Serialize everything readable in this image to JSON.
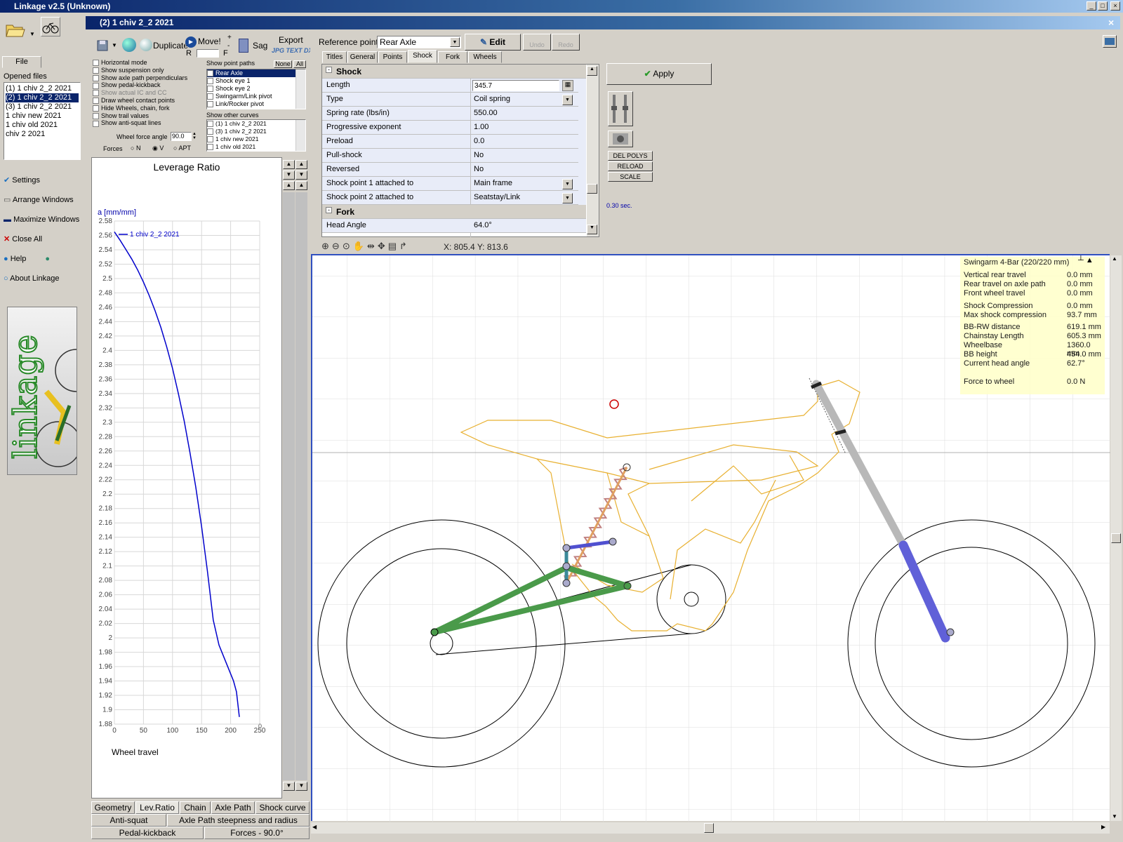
{
  "app": {
    "title": "Linkage v2.5 (Unknown)"
  },
  "child": {
    "title": "(2) 1 chiv 2_2 2021"
  },
  "left_panel": {
    "file_tab": "File",
    "opened_files_label": "Opened files",
    "files": [
      "(1) 1 chiv 2_2 2021",
      "(2) 1 chiv 2_2 2021",
      "(3) 1 chiv 2_2 2021",
      "1 chiv new 2021",
      "1 chiv old 2021",
      "chiv 2 2021"
    ],
    "menu": [
      "Settings",
      "Arrange Windows",
      "Maximize Windows",
      "Close All",
      "Help",
      "About Linkage"
    ],
    "logo_text": "linkage"
  },
  "toolbar": {
    "duplicate": "Duplicate",
    "move": "Move!",
    "sag": "Sag",
    "export": "Export",
    "export_formats": "JPG TEXT DXF",
    "r": "R",
    "f": "F",
    "plus": "+",
    "minus": "-"
  },
  "options": {
    "checkboxes": [
      "Horizontal mode",
      "Show suspension only",
      "Show axle path perpendiculars",
      "Show pedal-kickback",
      "Show actual IC and CC",
      "Draw wheel contact points",
      "Hide Wheels, chain, fork",
      "Show trail values",
      "Show anti-squat lines"
    ],
    "wheel_force_angle_label": "Wheel force angle",
    "wheel_force_angle_value": "90.0",
    "forces_label": "Forces",
    "forces_opts": [
      "N",
      "V",
      "APT"
    ],
    "point_paths_label": "Show point paths",
    "none": "None",
    "all": "All",
    "point_paths": [
      "Rear Axle",
      "Shock eye 1",
      "Shock eye 2",
      "Swingarm/Link pivot",
      "Link/Rocker pivot"
    ],
    "other_curves_label": "Show other curves",
    "other_curves": [
      "(1) 1 chiv 2_2 2021",
      "(3) 1 chiv 2_2 2021",
      "1 chiv new 2021",
      "1 chiv old 2021"
    ]
  },
  "chart_data": {
    "type": "line",
    "title": "Leverage Ratio",
    "ylabel": "a [mm/mm]",
    "xlabel": "Wheel travel",
    "xlim": [
      0,
      250
    ],
    "ylim": [
      1.88,
      2.58
    ],
    "xticks": [
      "0",
      "50",
      "100",
      "150",
      "200",
      "250"
    ],
    "yticks": [
      "2.58",
      "2.56",
      "2.54",
      "2.52",
      "2.5",
      "2.48",
      "2.46",
      "2.44",
      "2.42",
      "2.4",
      "2.38",
      "2.36",
      "2.34",
      "2.32",
      "2.3",
      "2.28",
      "2.26",
      "2.24",
      "2.22",
      "2.2",
      "2.18",
      "2.16",
      "2.14",
      "2.12",
      "2.1",
      "2.08",
      "2.06",
      "2.04",
      "2.02",
      "2",
      "1.98",
      "1.96",
      "1.94",
      "1.92",
      "1.9",
      "1.88"
    ],
    "end_label": "0",
    "series": [
      {
        "name": "1 chiv 2_2 2021",
        "color": "#0000cc",
        "x": [
          0,
          10,
          20,
          30,
          40,
          50,
          60,
          70,
          80,
          90,
          100,
          110,
          120,
          130,
          140,
          150,
          160,
          170,
          180,
          190,
          200,
          205,
          210,
          215
        ],
        "y": [
          2.565,
          2.553,
          2.54,
          2.527,
          2.512,
          2.495,
          2.476,
          2.455,
          2.432,
          2.405,
          2.375,
          2.34,
          2.302,
          2.258,
          2.21,
          2.155,
          2.093,
          2.025,
          1.99,
          1.97,
          1.95,
          1.94,
          1.925,
          1.89
        ]
      }
    ]
  },
  "bottom_tabs": {
    "row1": [
      "Geometry",
      "Lev.Ratio",
      "Chain",
      "Axle Path",
      "Shock curve"
    ],
    "row2": [
      "Anti-squat",
      "Axle Path steepness and radius"
    ],
    "row3": [
      "Pedal-kickback",
      "Forces - 90.0°"
    ]
  },
  "properties": {
    "reference_label": "Reference point",
    "reference_value": "Rear Axle",
    "edit": "Edit",
    "undo": "Undo",
    "redo": "Redo",
    "tabs": [
      "Titles",
      "General",
      "Points",
      "Shock",
      "Fork",
      "Wheels"
    ],
    "sections": {
      "shock": "Shock",
      "fork": "Fork"
    },
    "rows": [
      {
        "name": "Length",
        "value": "345.7"
      },
      {
        "name": "Type",
        "value": "Coil spring"
      },
      {
        "name": "Spring rate (lbs/in)",
        "value": "550.00"
      },
      {
        "name": "Progressive exponent",
        "value": "1.00"
      },
      {
        "name": "Preload",
        "value": "0.0"
      },
      {
        "name": "Pull-shock",
        "value": "No"
      },
      {
        "name": "Reversed",
        "value": "No"
      },
      {
        "name": "Shock point 1 attached to",
        "value": "Main frame"
      },
      {
        "name": "Shock point 2 attached to",
        "value": "Seatstay/Link"
      }
    ],
    "fork_rows": [
      {
        "name": "Head Angle",
        "value": "64.0°"
      }
    ]
  },
  "actions": {
    "apply": "Apply",
    "del_polys": "DEL POLYS",
    "reload": "RELOAD",
    "scale": "SCALE",
    "timing": "0.30 sec."
  },
  "canvas": {
    "coords": "X: 805.4  Y: 813.6"
  },
  "info": {
    "title": "Swingarm 4-Bar (220/220 mm)",
    "rows": [
      {
        "k": "Vertical rear travel",
        "v": "0.0 mm"
      },
      {
        "k": "Rear travel on axle path",
        "v": "0.0 mm"
      },
      {
        "k": "Front wheel travel",
        "v": "0.0 mm"
      },
      {
        "k": "Shock Compression",
        "v": "0.0 mm"
      },
      {
        "k": "Max shock compression",
        "v": "93.7 mm"
      },
      {
        "k": "BB-RW distance",
        "v": "619.1 mm"
      },
      {
        "k": "Chainstay Length",
        "v": "605.3 mm"
      },
      {
        "k": "Wheelbase",
        "v": "1360.0 mm"
      },
      {
        "k": "BB height",
        "v": "454.0 mm"
      },
      {
        "k": "Current head angle",
        "v": "62.7°"
      },
      {
        "k": "Force to wheel",
        "v": "0.0 N"
      }
    ]
  }
}
